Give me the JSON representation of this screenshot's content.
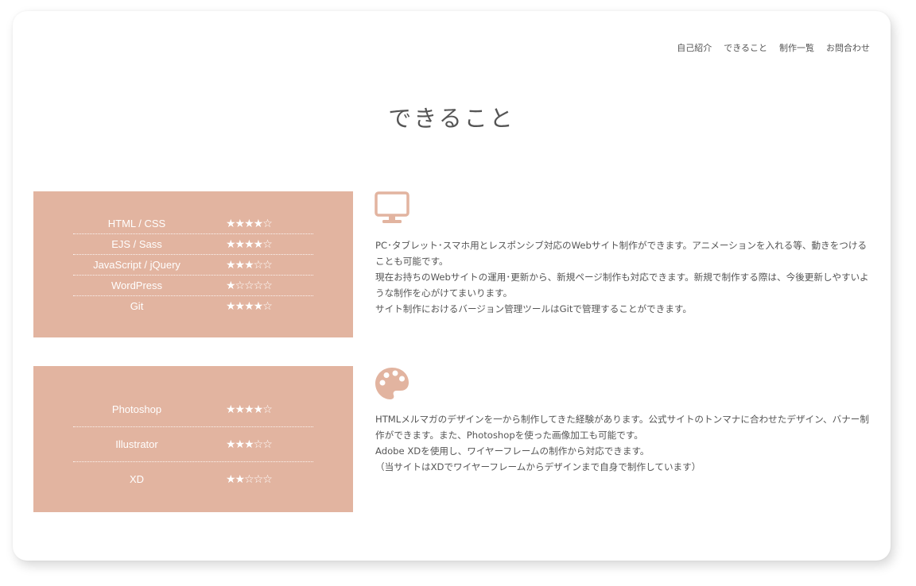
{
  "nav": {
    "items": [
      "自己紹介",
      "できること",
      "制作一覧",
      "お問合わせ"
    ]
  },
  "page": {
    "title": "できること"
  },
  "colors": {
    "skill_box_bg": "#e2b4a0",
    "icon_color": "#e2b4a0",
    "text": "#555555"
  },
  "web_skills": {
    "icon": "monitor-icon",
    "rows": [
      {
        "name": "HTML / CSS",
        "stars": "★★★★☆",
        "rating": 4
      },
      {
        "name": "EJS / Sass",
        "stars": "★★★★☆",
        "rating": 4
      },
      {
        "name": "JavaScript / jQuery",
        "stars": "★★★☆☆",
        "rating": 3
      },
      {
        "name": "WordPress",
        "stars": "★☆☆☆☆",
        "rating": 1
      },
      {
        "name": "Git",
        "stars": "★★★★☆",
        "rating": 4
      }
    ],
    "description": [
      "PC･タブレット･スマホ用とレスポンシブ対応のWebサイト制作ができます。アニメーションを入れる等、動きをつけることも可能です。",
      "現在お持ちのWebサイトの運用･更新から、新規ページ制作も対応できます。新規で制作する際は、今後更新しやすいような制作を心がけてまいります。",
      "サイト制作におけるバージョン管理ツールはGitで管理することができます。"
    ]
  },
  "design_skills": {
    "icon": "palette-icon",
    "rows": [
      {
        "name": "Photoshop",
        "stars": "★★★★☆",
        "rating": 4
      },
      {
        "name": "Illustrator",
        "stars": "★★★☆☆",
        "rating": 3
      },
      {
        "name": "XD",
        "stars": "★★☆☆☆",
        "rating": 2
      }
    ],
    "description": [
      "HTMLメルマガのデザインを一から制作してきた経験があります。公式サイトのトンマナに合わせたデザイン、バナー制作ができます。また、Photoshopを使った画像加工も可能です。",
      "Adobe XDを使用し、ワイヤーフレームの制作から対応できます。",
      "（当サイトはXDでワイヤーフレームからデザインまで自身で制作しています）"
    ]
  }
}
